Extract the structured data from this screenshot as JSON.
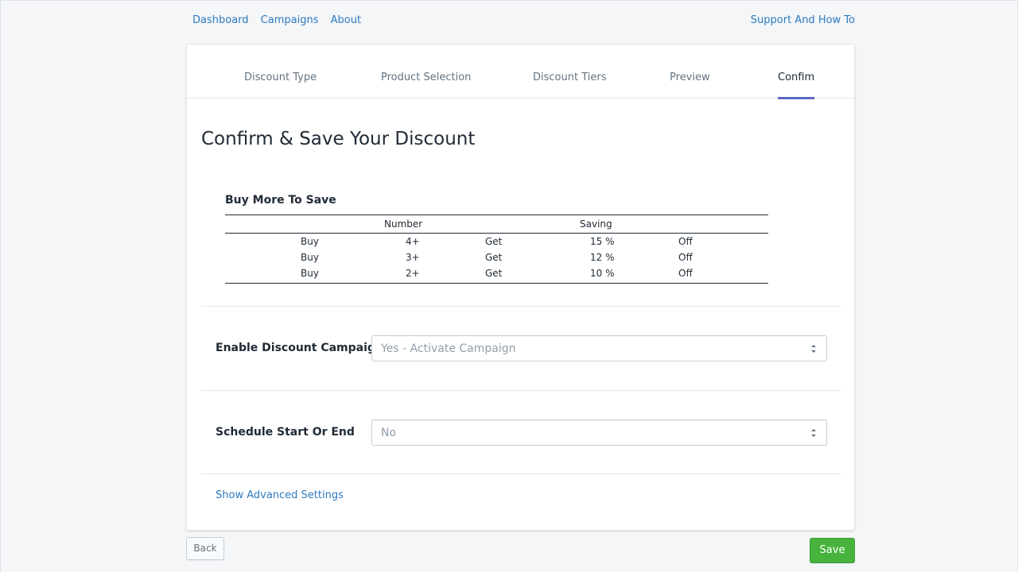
{
  "nav": {
    "dashboard": "Dashboard",
    "campaigns": "Campaigns",
    "about": "About",
    "support": "Support And How To"
  },
  "steps": {
    "discount_type": "Discount Type",
    "product_selection": "Product Selection",
    "discount_tiers": "Discount Tiers",
    "preview": "Preview",
    "confirm": "Confim",
    "active": "confirm"
  },
  "page_title": "Confirm & Save Your Discount",
  "tiers": {
    "title": "Buy More To Save",
    "headers": {
      "number": "Number",
      "saving": "Saving"
    },
    "rows": [
      {
        "buy": "Buy",
        "number": "4+",
        "get": "Get",
        "saving": "15 %",
        "off": "Off"
      },
      {
        "buy": "Buy",
        "number": "3+",
        "get": "Get",
        "saving": "12 %",
        "off": "Off"
      },
      {
        "buy": "Buy",
        "number": "2+",
        "get": "Get",
        "saving": "10 %",
        "off": "Off"
      }
    ]
  },
  "enable_campaign": {
    "label": "Enable Discount Campaign",
    "value": "Yes - Activate Campaign"
  },
  "schedule": {
    "label": "Schedule Start Or End",
    "value": "No"
  },
  "advanced_link": "Show Advanced Settings",
  "buttons": {
    "back": "Back",
    "save": "Save"
  },
  "colors": {
    "accent": "#5c6ac4",
    "link": "#2c7ac0",
    "save": "#47b33d"
  },
  "icons": {
    "select_arrows": "chevron-up-down-icon"
  }
}
